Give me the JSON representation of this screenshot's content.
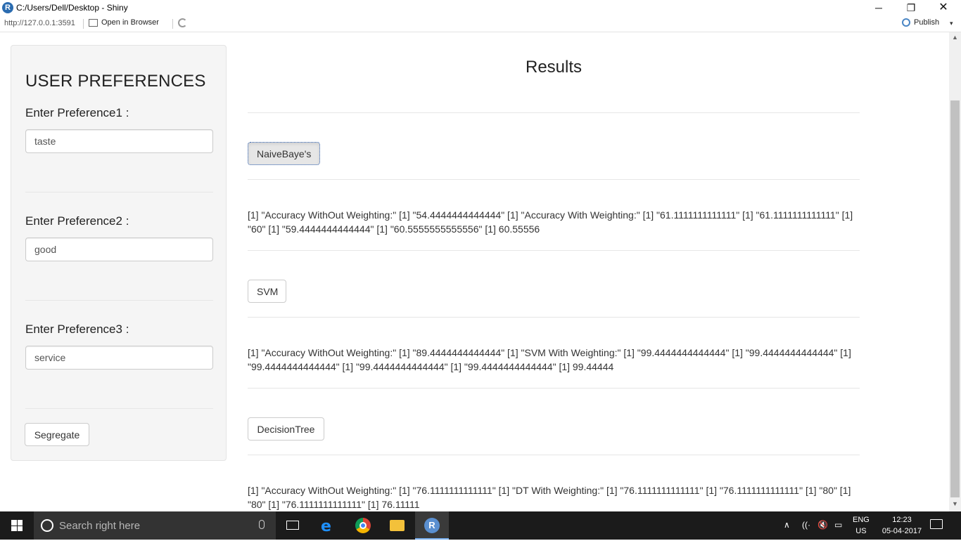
{
  "window": {
    "title": "C:/Users/Dell/Desktop - Shiny",
    "minimize_glyph": "─",
    "maximize_glyph": "❐",
    "close_glyph": "✕"
  },
  "toolbar": {
    "url": "http://127.0.0.1:3591",
    "open_in_browser": "Open in Browser",
    "publish": "Publish",
    "publish_caret": "▾"
  },
  "sidebar": {
    "title": "USER PREFERENCES",
    "preferences": [
      {
        "label": "Enter Preference1 :",
        "value": "taste"
      },
      {
        "label": "Enter Preference2 :",
        "value": "good"
      },
      {
        "label": "Enter Preference3 :",
        "value": "service"
      }
    ],
    "segregate_button": "Segregate"
  },
  "main": {
    "title": "Results",
    "sections": [
      {
        "button": "NaiveBaye's",
        "output": "[1] \"Accuracy WithOut Weighting:\" [1] \"54.4444444444444\" [1] \"Accuracy With Weighting:\" [1] \"61.1111111111111\" [1] \"61.1111111111111\" [1] \"60\" [1] \"59.4444444444444\" [1] \"60.5555555555556\" [1] 60.55556"
      },
      {
        "button": "SVM",
        "output": "[1] \"Accuracy WithOut Weighting:\" [1] \"89.4444444444444\" [1] \"SVM With Weighting:\" [1] \"99.4444444444444\" [1] \"99.4444444444444\" [1] \"99.4444444444444\" [1] \"99.4444444444444\" [1] \"99.4444444444444\" [1] 99.44444"
      },
      {
        "button": "DecisionTree",
        "output": "[1] \"Accuracy WithOut Weighting:\" [1] \"76.1111111111111\" [1] \"DT With Weighting:\" [1] \"76.1111111111111\" [1] \"76.1111111111111\" [1] \"80\" [1] \"80\" [1] \"76.1111111111111\" [1] 76.11111"
      }
    ]
  },
  "taskbar": {
    "search_placeholder": "Search right here",
    "lang_top": "ENG",
    "lang_bottom": "US",
    "time": "12:23",
    "date": "05-04-2017",
    "tray_glyphs": {
      "up": "∧",
      "network": "((·",
      "volume": "🔇",
      "battery": "▭"
    }
  },
  "colors": {
    "accent": "#2a5db0",
    "panel_bg": "#f5f5f5",
    "taskbar_bg": "#1b1b1b"
  }
}
